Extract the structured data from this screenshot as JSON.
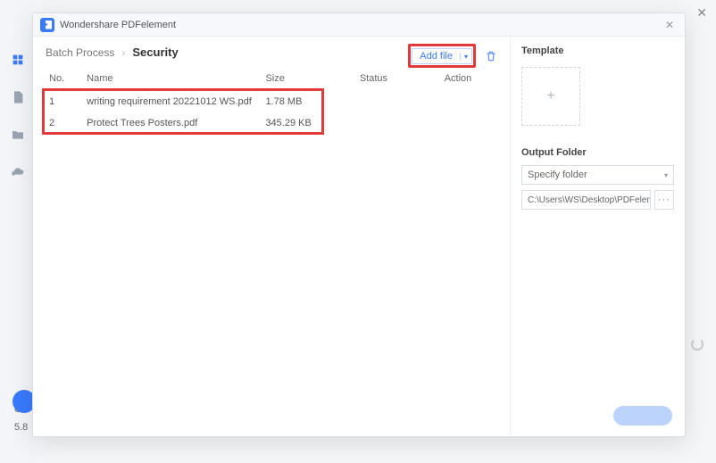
{
  "app": {
    "title": "Wondershare PDFelement"
  },
  "breadcrumb": {
    "root": "Batch Process",
    "current": "Security"
  },
  "addFile": {
    "label": "Add file"
  },
  "table": {
    "headers": {
      "no": "No.",
      "name": "Name",
      "size": "Size",
      "status": "Status",
      "action": "Action"
    },
    "rows": [
      {
        "no": "1",
        "name": "writing requirement 20221012 WS.pdf",
        "size": "1.78 MB"
      },
      {
        "no": "2",
        "name": "Protect Trees Posters.pdf",
        "size": "345.29 KB"
      }
    ]
  },
  "side": {
    "template": "Template",
    "outputFolder": "Output Folder",
    "specify": "Specify folder",
    "path": "C:\\Users\\WS\\Desktop\\PDFelement\\Sec"
  },
  "bottom": {
    "c": "Cl",
    "v": "5.8"
  }
}
